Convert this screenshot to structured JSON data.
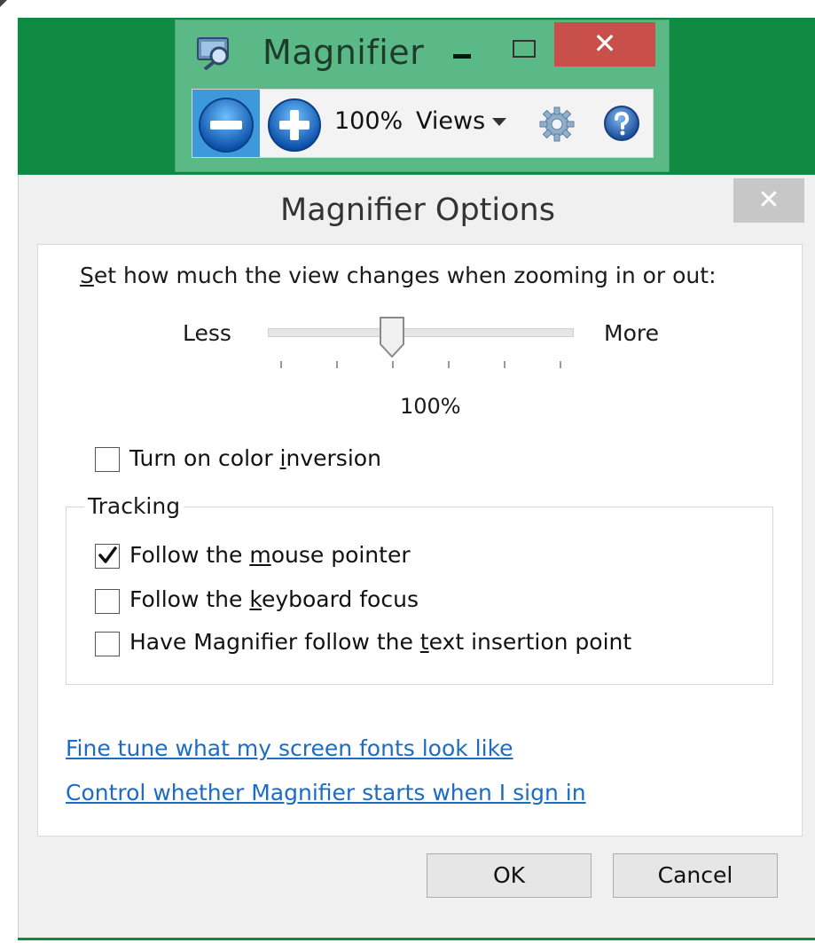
{
  "magnifier_window": {
    "title": "Magnifier",
    "close_glyph": "✕",
    "zoom_level": "100%",
    "views_label": "Views",
    "icons": {
      "app": "magnifier-app-icon",
      "zoom_out": "zoom-out-icon",
      "zoom_in": "zoom-in-icon",
      "settings": "gear-icon",
      "help": "help-icon"
    }
  },
  "options_dialog": {
    "title": "Magnifier Options",
    "close_glyph": "✕",
    "zoom_prompt": {
      "accel": "S",
      "rest": "et how much the view changes when zooming in or out:"
    },
    "slider": {
      "min_label": "Less",
      "max_label": "More",
      "value_label": "100%",
      "position": 2,
      "ticks": 6
    },
    "color_inversion": {
      "pre": "Turn on color ",
      "accel": "i",
      "post": "nversion",
      "checked": false
    },
    "tracking": {
      "legend": "Tracking",
      "options": [
        {
          "pre": "Follow the ",
          "accel": "m",
          "post": "ouse pointer",
          "checked": true
        },
        {
          "pre": "Follow the ",
          "accel": "k",
          "post": "eyboard focus",
          "checked": false
        },
        {
          "pre": "Have Magnifier follow the ",
          "accel": "t",
          "post": "ext insertion point",
          "checked": false
        }
      ]
    },
    "links": {
      "fonts": "Fine tune what my screen fonts look like",
      "sign_in": "Control whether Magnifier starts when I sign in"
    },
    "buttons": {
      "ok": "OK",
      "cancel": "Cancel"
    }
  },
  "colors": {
    "desktop": "#0f8a43",
    "magnifier_frame": "#5bb987",
    "close_red": "#c9504a",
    "zoom_blue": "#3d99d9",
    "link": "#1c6cc4"
  }
}
